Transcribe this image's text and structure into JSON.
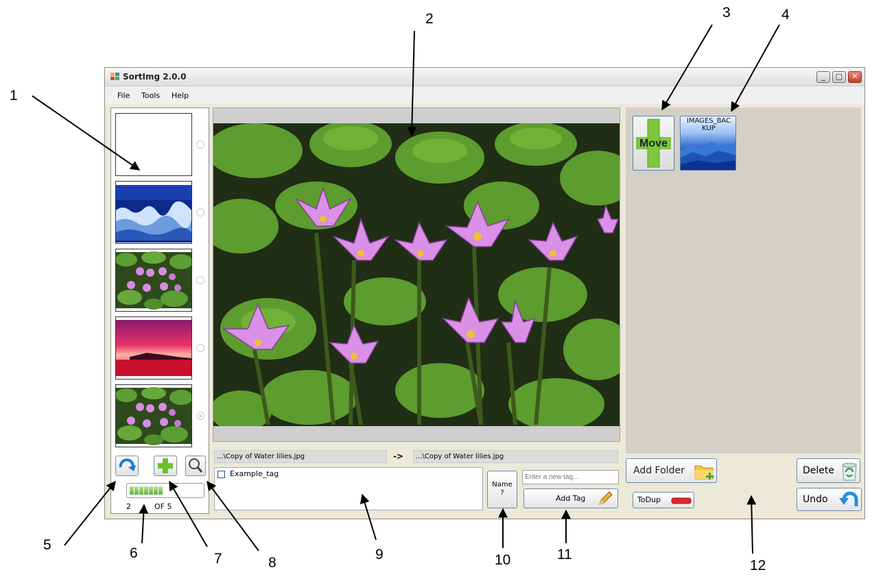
{
  "window": {
    "title": "SortImg 2.0.0",
    "menu": [
      "File",
      "Tools",
      "Help"
    ]
  },
  "left_panel": {
    "thumbnails": [
      {
        "name": "blank"
      },
      {
        "name": "winter"
      },
      {
        "name": "water-lilies"
      },
      {
        "name": "sunset"
      },
      {
        "name": "water-lilies"
      }
    ],
    "selected_index": 4,
    "progress": {
      "segments_filled": 7,
      "fraction": 0.5
    },
    "counter": {
      "current": "2",
      "of_label": "OF 5"
    }
  },
  "center": {
    "source_path": "...\\Copy of Water lilies.jpg",
    "arrow": "->",
    "dest_path": "...\\Copy of Water lilies.jpg",
    "tags": [
      {
        "label": "Example_tag",
        "checked": false
      }
    ],
    "tag_input_placeholder": "Enter a new tag...",
    "name_button": "Name\n?",
    "add_tag_button": "Add Tag"
  },
  "right_panel": {
    "move_button": "Move",
    "folder_button": "IMAGES_BAC\nKUP",
    "add_folder_button": "Add Folder",
    "todup_button": "ToDup",
    "delete_button": "Delete",
    "undo_button": "Undo"
  },
  "callouts": [
    "1",
    "2",
    "3",
    "4",
    "5",
    "6",
    "7",
    "8",
    "9",
    "10",
    "11",
    "12"
  ],
  "colors": {
    "window_bg": "#ece9d8",
    "right_panel_bg": "#d4d0c8",
    "move_green": "#7ec63e"
  }
}
